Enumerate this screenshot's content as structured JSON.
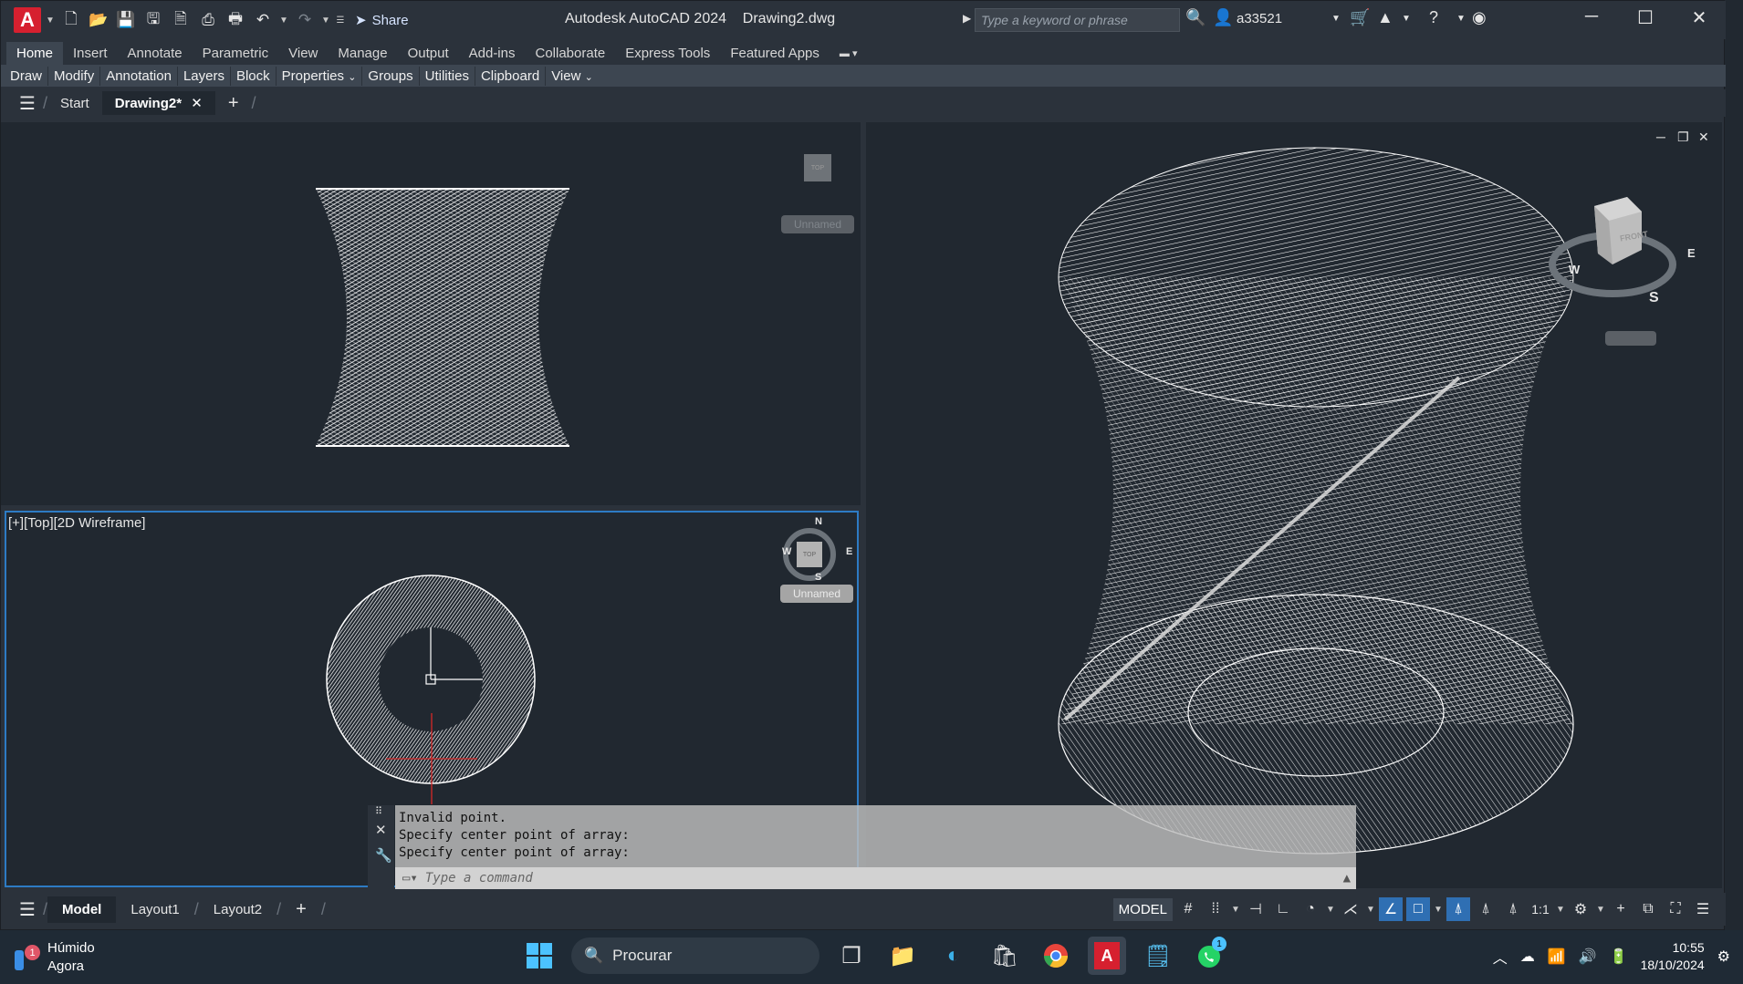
{
  "titlebar": {
    "app_title": "Autodesk AutoCAD 2024",
    "file_title": "Drawing2.dwg",
    "share_label": "Share",
    "search_placeholder": "Type a keyword or phrase",
    "username": "a33521"
  },
  "ribbon": {
    "tabs": [
      "Home",
      "Insert",
      "Annotate",
      "Parametric",
      "View",
      "Manage",
      "Output",
      "Add-ins",
      "Collaborate",
      "Express Tools",
      "Featured Apps"
    ],
    "active_tab": "Home",
    "panels": [
      "Draw",
      "Modify",
      "Annotation",
      "Layers",
      "Block",
      "Properties",
      "Groups",
      "Utilities",
      "Clipboard",
      "View"
    ]
  },
  "file_tabs": {
    "start": "Start",
    "active": "Drawing2*"
  },
  "viewports": {
    "bottom_left_label": "[+][Top][2D Wireframe]",
    "view_name": "Unnamed",
    "compass": {
      "n": "N",
      "s": "S",
      "e": "E",
      "w": "W"
    },
    "cube_top": "TOP",
    "cube_front": "FRONT"
  },
  "command_line": {
    "history": [
      "Invalid point.",
      "Specify center point of array:",
      "Specify center point of array:"
    ],
    "placeholder": "Type a command"
  },
  "layout_tabs": [
    "Model",
    "Layout1",
    "Layout2"
  ],
  "status_bar": {
    "space": "MODEL",
    "scale": "1:1"
  },
  "taskbar": {
    "weather": "Húmido",
    "weather_sub": "Agora",
    "weather_badge": "1",
    "search_label": "Procurar",
    "whatsapp_badge": "1",
    "time": "10:55",
    "date": "18/10/2024"
  },
  "colors": {
    "accent": "#2d7bc4",
    "autocad_red": "#d6202f",
    "canvas": "#212830"
  }
}
